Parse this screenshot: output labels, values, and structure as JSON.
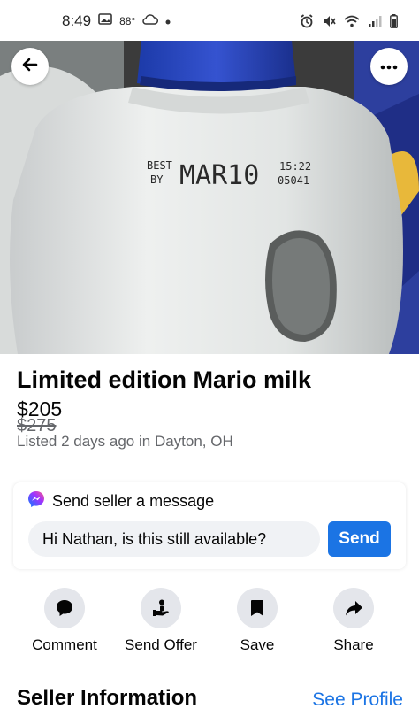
{
  "status_bar": {
    "time": "8:49",
    "temperature": "88°",
    "icons": [
      "photo-icon",
      "cloud-icon",
      "dot-icon",
      "alarm-icon",
      "mute-icon",
      "wifi-icon",
      "signal-icon",
      "battery-icon"
    ]
  },
  "photo": {
    "label_line1": "BEST",
    "label_line2": "BY",
    "label_date": "MAR10",
    "label_time": "15:22",
    "label_code": "05041"
  },
  "nav": {
    "back_icon": "arrow-left-icon",
    "more_icon": "more-horizontal-icon"
  },
  "listing": {
    "title": "Limited edition Mario milk",
    "price": "$205",
    "original_price": "$275",
    "listed": "Listed 2 days ago in Dayton, OH"
  },
  "message": {
    "header": "Send seller a message",
    "header_icon": "messenger-icon",
    "input_value": "Hi Nathan, is this still available?",
    "send_label": "Send"
  },
  "actions": [
    {
      "label": "Comment",
      "icon": "comment-icon"
    },
    {
      "label": "Send Offer",
      "icon": "offer-icon"
    },
    {
      "label": "Save",
      "icon": "bookmark-icon"
    },
    {
      "label": "Share",
      "icon": "share-icon"
    }
  ],
  "seller": {
    "title": "Seller Information",
    "see_profile": "See Profile"
  },
  "colors": {
    "accent": "#1b74e4",
    "secondary_text": "#65676b",
    "chip_bg": "#e4e6eb",
    "input_bg": "#f0f2f5"
  }
}
